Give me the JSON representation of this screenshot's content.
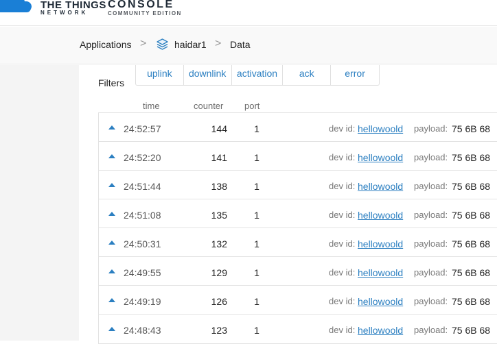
{
  "brand": {
    "line1": "THE THINGS",
    "line2": "NETWORK",
    "console": "CONSOLE",
    "edition": "COMMUNITY EDITION"
  },
  "breadcrumb": {
    "applications": "Applications",
    "app": "haidar1",
    "page": "Data",
    "separator": ">"
  },
  "filters": {
    "label": "Filters",
    "tabs": [
      "uplink",
      "downlink",
      "activation",
      "ack",
      "error"
    ]
  },
  "columns": {
    "time": "time",
    "counter": "counter",
    "port": "port"
  },
  "row_labels": {
    "devid": "dev id:",
    "payload": "payload:"
  },
  "rows": [
    {
      "time": "24:52:57",
      "counter": "144",
      "port": "1",
      "dev_id": "hellowoold",
      "payload": "75 6B 68"
    },
    {
      "time": "24:52:20",
      "counter": "141",
      "port": "1",
      "dev_id": "hellowoold",
      "payload": "75 6B 68"
    },
    {
      "time": "24:51:44",
      "counter": "138",
      "port": "1",
      "dev_id": "hellowoold",
      "payload": "75 6B 68"
    },
    {
      "time": "24:51:08",
      "counter": "135",
      "port": "1",
      "dev_id": "hellowoold",
      "payload": "75 6B 68"
    },
    {
      "time": "24:50:31",
      "counter": "132",
      "port": "1",
      "dev_id": "hellowoold",
      "payload": "75 6B 68"
    },
    {
      "time": "24:49:55",
      "counter": "129",
      "port": "1",
      "dev_id": "hellowoold",
      "payload": "75 6B 68"
    },
    {
      "time": "24:49:19",
      "counter": "126",
      "port": "1",
      "dev_id": "hellowoold",
      "payload": "75 6B 68"
    },
    {
      "time": "24:48:43",
      "counter": "123",
      "port": "1",
      "dev_id": "hellowoold",
      "payload": "75 6B 68"
    }
  ],
  "icons": {
    "logo": "ttn-cloud-logo",
    "app": "stack-layers-icon",
    "uplink": "uplink-arrow-icon"
  },
  "colors": {
    "accent": "#2b7fc1",
    "brand_blue": "#1a7fd6",
    "text": "#222222"
  }
}
